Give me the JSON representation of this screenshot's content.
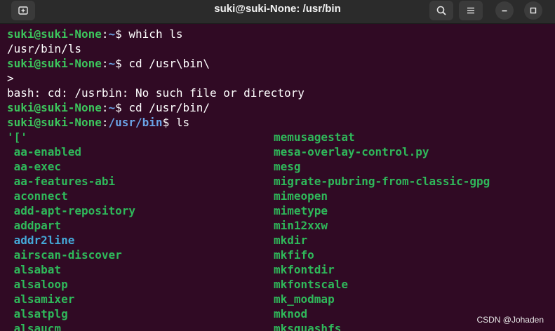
{
  "window": {
    "title": "suki@suki-None: /usr/bin",
    "new_tab_icon": "new-tab-icon",
    "search_icon": "search-icon",
    "menu_icon": "hamburger-menu-icon",
    "minimize_icon": "minimize-icon",
    "maximize_icon": "maximize-icon"
  },
  "terminal": {
    "lines": [
      {
        "user": "suki@suki-None",
        "sep": ":",
        "path": "~",
        "dollar": "$ ",
        "cmd": "which ls"
      },
      {
        "text": "/usr/bin/ls"
      },
      {
        "user": "suki@suki-None",
        "sep": ":",
        "path": "~",
        "dollar": "$ ",
        "cmd": "cd /usr\\bin\\"
      },
      {
        "text": ">"
      },
      {
        "text": "bash: cd: /usrbin: No such file or directory"
      },
      {
        "user": "suki@suki-None",
        "sep": ":",
        "path": "~",
        "dollar": "$ ",
        "cmd": "cd /usr/bin/"
      },
      {
        "user": "suki@suki-None",
        "sep": ":",
        "path": "/usr/bin",
        "dollar": "$ ",
        "cmd": "ls"
      }
    ],
    "listing_left": [
      "'['",
      " aa-enabled",
      " aa-exec",
      " aa-features-abi",
      " aconnect",
      " add-apt-repository",
      " addpart",
      " addr2line",
      " airscan-discover",
      " alsabat",
      " alsaloop",
      " alsamixer",
      " alsatplg",
      " alsaucm"
    ],
    "listing_right": [
      "memusagestat",
      "mesa-overlay-control.py",
      "mesg",
      "migrate-pubring-from-classic-gpg",
      "mimeopen",
      "mimetype",
      "min12xxw",
      "mkdir",
      "mkfifo",
      "mkfontdir",
      "mkfontscale",
      "mk_modmap",
      "mknod",
      "mksquashfs"
    ],
    "link_items": [
      " addr2line"
    ]
  },
  "watermark": "CSDN @Johaden",
  "colors": {
    "background": "#300a24",
    "prompt_user": "#3cc45c",
    "prompt_path": "#6aa3e6",
    "executable": "#2fb85a",
    "symlink": "#44a8d8"
  }
}
